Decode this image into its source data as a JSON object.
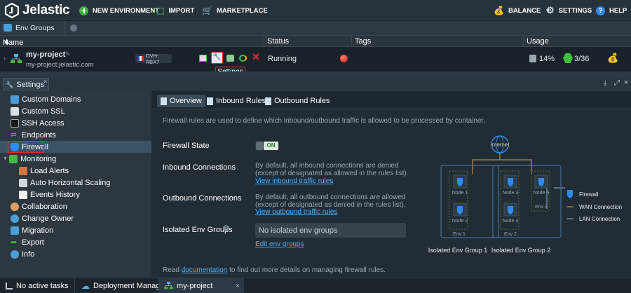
{
  "topbar": {
    "brand": "Jelastic",
    "new_env": "NEW ENVIRONMENT",
    "import": "IMPORT",
    "marketplace": "MARKETPLACE",
    "balance": "BALANCE",
    "settings": "SETTINGS",
    "help": "HELP"
  },
  "breadcrumb": {
    "env_groups": "Env Groups"
  },
  "grid": {
    "col_name": "Name",
    "col_status": "Status",
    "col_tags": "Tags",
    "col_usage": "Usage"
  },
  "env": {
    "name": "my-project",
    "domain": "my-project.jelastic.com",
    "region": "OVH-RBX7",
    "status": "Running",
    "usage_percent": "14%",
    "cloudlets": "3/36"
  },
  "tooltip": "Settings",
  "panel": {
    "title": "Settings"
  },
  "sidebar": {
    "items": [
      "Custom Domains",
      "Custom SSL",
      "SSH Access",
      "Endpoints",
      "Firewall",
      "Monitoring",
      "Load Alerts",
      "Auto Horizontal Scaling",
      "Events History",
      "Collaboration",
      "Change Owner",
      "Migration",
      "Export",
      "Info"
    ]
  },
  "tabs": {
    "overview": "Overview",
    "inbound": "Inbound Rules",
    "outbound": "Outbound Rules"
  },
  "firewall": {
    "intro": "Firewall rules are used to define which inbound/outbound traffic is allowed to be processed by container.",
    "state_label": "Firewall State",
    "state_value": "ON",
    "inbound_label": "Inbound Connections",
    "inbound_desc1": "By default, all inbound connections are denied",
    "inbound_desc2": "(except of designated as allowed in the rules list).",
    "inbound_link": "View inbound traffic rules",
    "outbound_label": "Outbound Connections",
    "outbound_desc1": "By default, all outbound connections are allowed",
    "outbound_desc2": "(except of designated as denied in the rules list).",
    "outbound_link": "View outbound traffic rules",
    "iso_label": "Isolated Env Groups",
    "iso_value": "No isolated env groups",
    "iso_link": "Edit env groups",
    "footer_pre": "Read ",
    "footer_link": "documentation",
    "footer_post": " to find out more details on managing firewall rules."
  },
  "diagram": {
    "internet": "Internet",
    "node1": "Node 1",
    "node2": "Node 2",
    "node3": "Node 3",
    "node4": "Node 4",
    "node5": "Node 5",
    "env1": "Env 1",
    "env2": "Env 2",
    "env3": "Env 3",
    "group1": "Isolated Env Group 1",
    "group2": "Isolated Env Group 2",
    "legend_firewall": "Firewall",
    "legend_wan": "WAN Connection",
    "legend_lan": "LAN Connection"
  },
  "bottom": {
    "tasks": "No active tasks",
    "deploy": "Deployment Manager",
    "project": "my-project"
  },
  "colors": {
    "accent": "#4ab4ff",
    "on_green": "#3fbf3f",
    "highlight": "#e02828",
    "firewall_blue": "#2d8cf0"
  }
}
